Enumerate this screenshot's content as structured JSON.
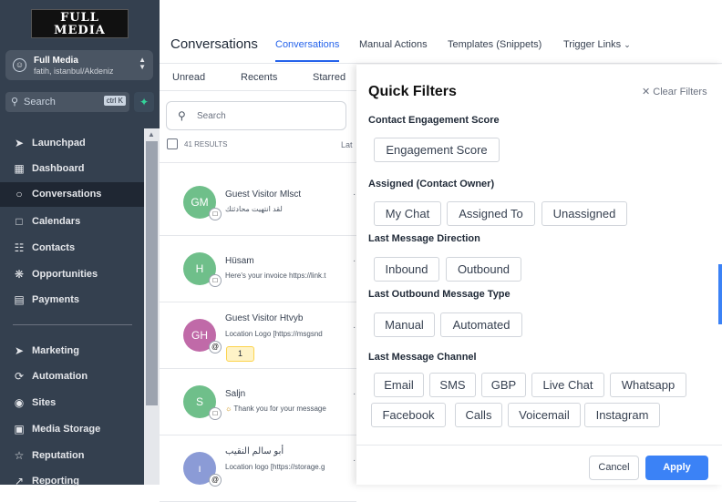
{
  "sidebar": {
    "logo": "FULL MEDIA",
    "account_name": "Full Media",
    "account_location": "fatih, istanbul/Akdeniz",
    "search_placeholder": "Search",
    "search_shortcut": "ctrl K",
    "items": [
      {
        "label": "Launchpad",
        "icon": "rocket-icon"
      },
      {
        "label": "Dashboard",
        "icon": "grid-icon"
      },
      {
        "label": "Conversations",
        "icon": "chat-icon"
      },
      {
        "label": "Calendars",
        "icon": "calendar-icon"
      },
      {
        "label": "Contacts",
        "icon": "contacts-icon"
      },
      {
        "label": "Opportunities",
        "icon": "opportunities-icon"
      },
      {
        "label": "Payments",
        "icon": "payments-icon"
      },
      {
        "label": "Marketing",
        "icon": "send-icon"
      },
      {
        "label": "Automation",
        "icon": "automation-icon"
      },
      {
        "label": "Sites",
        "icon": "globe-icon"
      },
      {
        "label": "Media Storage",
        "icon": "image-icon"
      },
      {
        "label": "Reputation",
        "icon": "star-icon"
      },
      {
        "label": "Reporting",
        "icon": "chart-icon"
      }
    ]
  },
  "header": {
    "title": "Conversations",
    "tabs": [
      "Conversations",
      "Manual Actions",
      "Templates (Snippets)",
      "Trigger Links"
    ]
  },
  "list": {
    "subtabs": [
      "Unread",
      "Recents",
      "Starred"
    ],
    "search_placeholder": "Search",
    "results": "41 RESULTS",
    "sort": "Lat",
    "rows": [
      {
        "initials": "GM",
        "name": "Guest Visitor Mlsct",
        "preview": "لقد انتهيت محادثتك",
        "color": "#6fbf8a",
        "badge": "chat"
      },
      {
        "initials": "H",
        "name": "Hüsam",
        "preview": "Here's your invoice https://link.t",
        "color": "#6fbf8a",
        "badge": "chat"
      },
      {
        "initials": "GH",
        "name": "Guest Visitor Htvyb",
        "preview": "Location Logo [https://msgsnd",
        "color": "#c06aa8",
        "badge": "at",
        "count": "1"
      },
      {
        "initials": "S",
        "name": "Saljn",
        "preview": "Thank you for your message",
        "color": "#6fbf8a",
        "badge": "chat"
      },
      {
        "initials": "ı",
        "name": "أبو سالم النقيب",
        "preview": "Location logo [https://storage.g",
        "color": "#8b9bd6",
        "badge": "at"
      }
    ]
  },
  "quick_filters": {
    "title": "Quick Filters",
    "clear": "Clear Filters",
    "sections": [
      {
        "title": "Contact Engagement Score",
        "chips": [
          "Engagement Score"
        ]
      },
      {
        "title": "Assigned (Contact Owner)",
        "chips": [
          "My Chat",
          "Assigned To",
          "Unassigned"
        ]
      },
      {
        "title": "Last Message Direction",
        "chips": [
          "Inbound",
          "Outbound"
        ]
      },
      {
        "title": "Last Outbound Message Type",
        "chips": [
          "Manual",
          "Automated"
        ]
      },
      {
        "title": "Last Message Channel",
        "chips": [
          "Email",
          "SMS",
          "GBP",
          "Live Chat",
          "Whatsapp",
          "Facebook",
          "Calls",
          "Voicemail",
          "Instagram"
        ]
      }
    ],
    "cancel": "Cancel",
    "apply": "Apply"
  }
}
